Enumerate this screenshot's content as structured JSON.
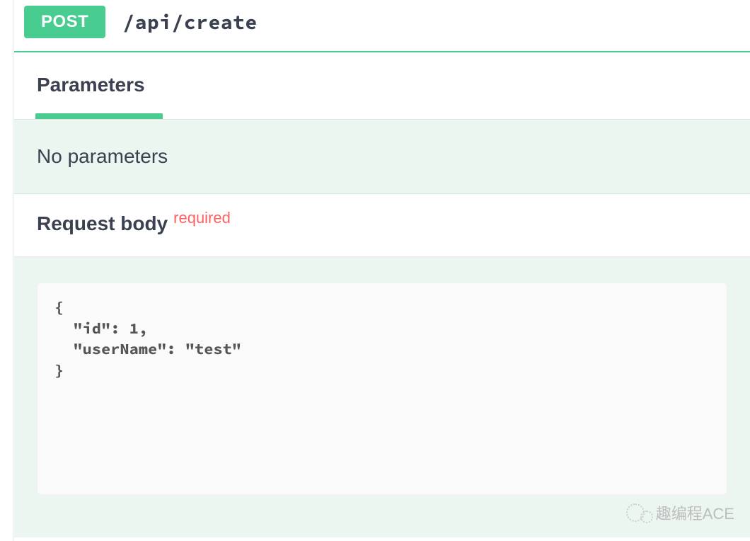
{
  "endpoint": {
    "method": "POST",
    "path": "/api/create"
  },
  "tabs": {
    "parameters_label": "Parameters"
  },
  "parameters": {
    "empty_message": "No parameters"
  },
  "request_body": {
    "label": "Request body",
    "required_label": "required",
    "example_json": "{\n  \"id\": 1,\n  \"userName\": \"test\"\n}"
  },
  "watermark": {
    "text": "趣编程ACE"
  }
}
